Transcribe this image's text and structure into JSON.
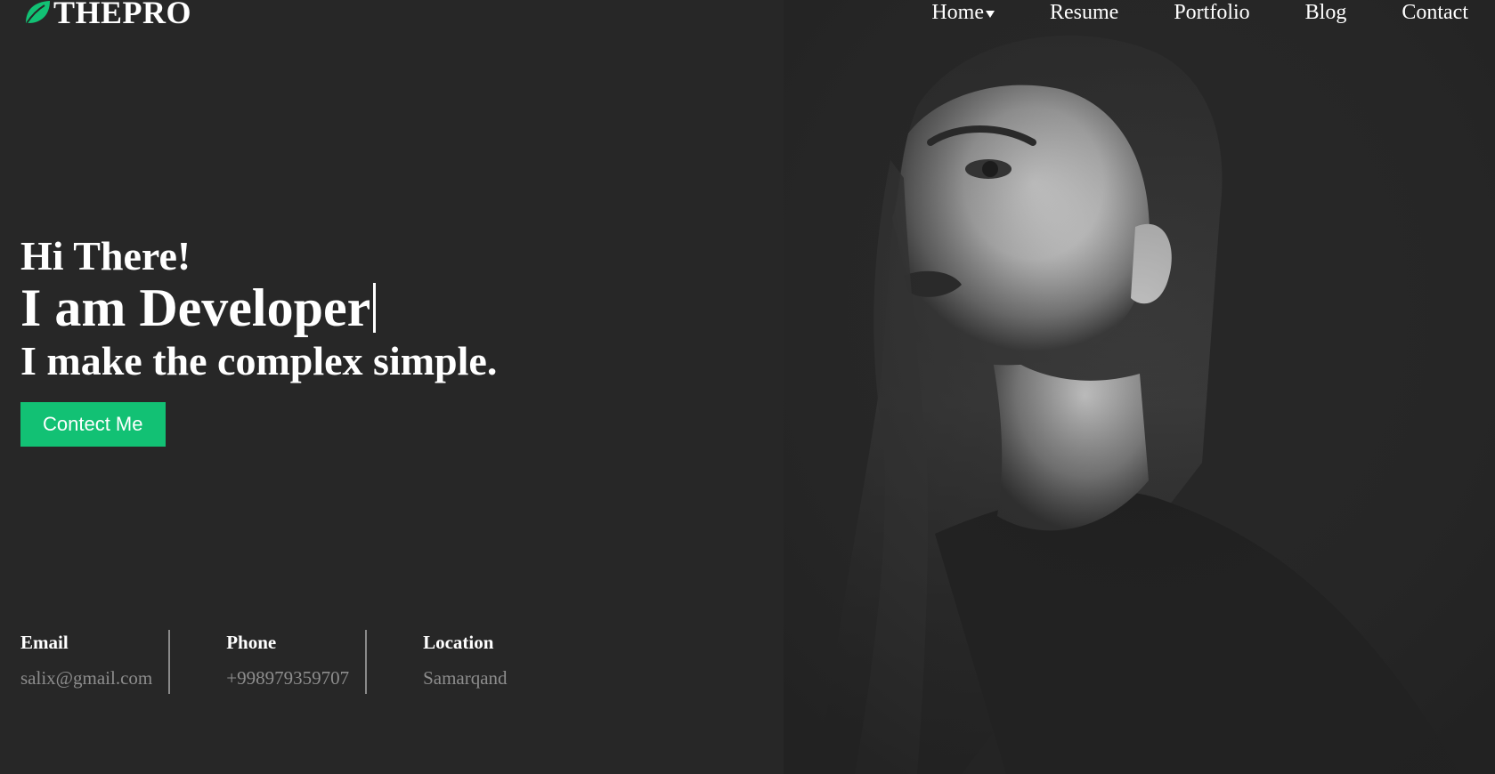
{
  "brand": {
    "name": "THEPRO",
    "accent_color": "#12c174",
    "icon": "leaf-icon"
  },
  "nav": {
    "items": [
      {
        "label": "Home",
        "has_dropdown": true
      },
      {
        "label": "Resume"
      },
      {
        "label": "Portfolio"
      },
      {
        "label": "Blog"
      },
      {
        "label": "Contact"
      }
    ]
  },
  "hero": {
    "greeting": "Hi There!",
    "headline": "I am Developer",
    "tagline": "I make the complex simple.",
    "cta_label": "Contect Me"
  },
  "contact_info": [
    {
      "label": "Email",
      "value": "salix@gmail.com"
    },
    {
      "label": "Phone",
      "value": "+998979359707"
    },
    {
      "label": "Location",
      "value": "Samarqand"
    }
  ],
  "colors": {
    "background": "#272727",
    "cta": "#12c174",
    "muted_text": "#8d8d8d"
  }
}
